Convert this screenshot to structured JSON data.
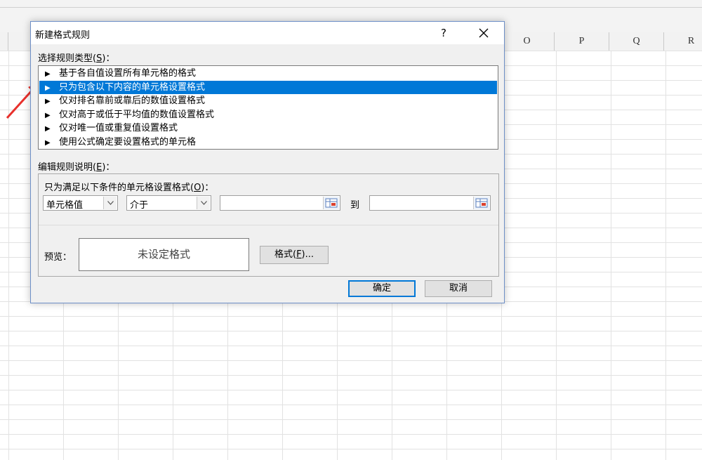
{
  "spreadsheet": {
    "columns": [
      "O",
      "P",
      "Q",
      "R"
    ]
  },
  "dialog": {
    "title": "新建格式规则",
    "help": "?",
    "select_type": {
      "label": "选择规则类型",
      "mnemonic": "S",
      "suffix": "："
    },
    "rule_types": [
      "基于各自值设置所有单元格的格式",
      "只为包含以下内容的单元格设置格式",
      "仅对排名靠前或靠后的数值设置格式",
      "仅对高于或低于平均值的数值设置格式",
      "仅对唯一值或重复值设置格式",
      "使用公式确定要设置格式的单元格"
    ],
    "selected_index": 1,
    "edit_desc": {
      "label": "编辑规则说明",
      "mnemonic": "E",
      "suffix": "："
    },
    "condition": {
      "label": "只为满足以下条件的单元格设置格式",
      "mnemonic": "O",
      "suffix": "：",
      "field": "单元格值",
      "operator": "介于",
      "value1": "",
      "to_label": "到",
      "value2": ""
    },
    "preview": {
      "label": "预览：",
      "text": "未设定格式"
    },
    "format_button": {
      "label": "格式",
      "mnemonic": "F",
      "suffix": "..."
    },
    "ok_label": "确定",
    "cancel_label": "取消"
  },
  "colors": {
    "selection": "#0078d7",
    "annotation_arrow": "#e8302c",
    "dialog_border": "#6d8fc7"
  }
}
